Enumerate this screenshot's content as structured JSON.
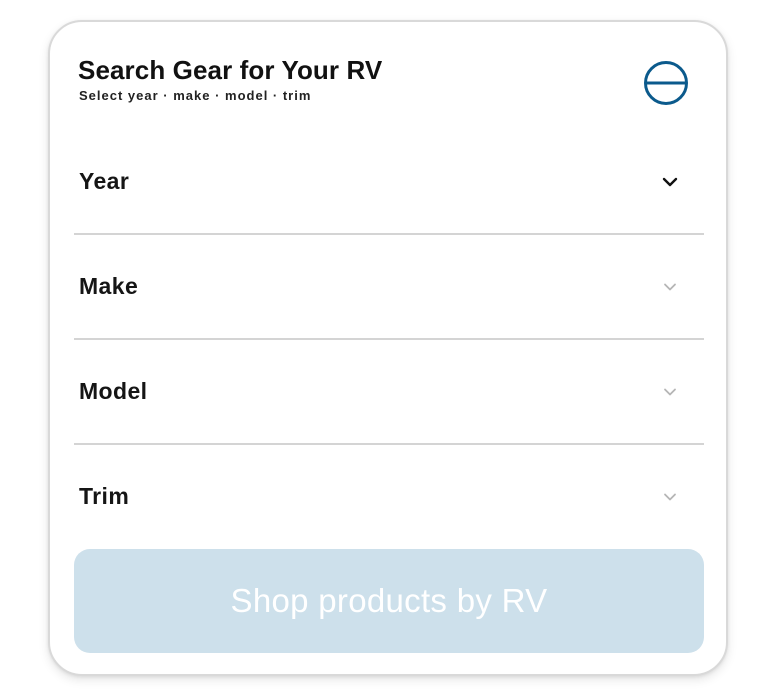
{
  "header": {
    "title": "Search Gear for Your RV",
    "subtitle": "Select year · make · model · trim",
    "collapse_icon": "circle-minus-icon"
  },
  "colors": {
    "accent": "#0b5a8c",
    "button_bg": "#cde0eb",
    "button_text": "#ffffff",
    "divider": "#d4d4d4",
    "chevron_active": "#111111",
    "chevron_disabled": "#b5b5b5"
  },
  "fields": [
    {
      "label": "Year",
      "icon": "chevron-down-icon",
      "enabled": true
    },
    {
      "label": "Make",
      "icon": "chevron-down-icon",
      "enabled": false
    },
    {
      "label": "Model",
      "icon": "chevron-down-icon",
      "enabled": false
    },
    {
      "label": "Trim",
      "icon": "chevron-down-icon",
      "enabled": false
    }
  ],
  "button": {
    "label": "Shop products by RV",
    "enabled": false
  }
}
